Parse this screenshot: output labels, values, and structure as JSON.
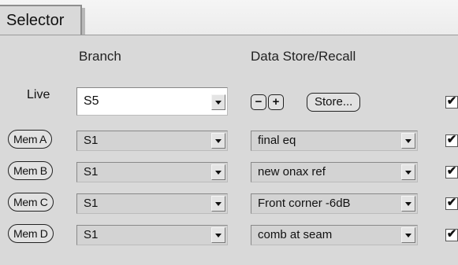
{
  "tab": {
    "label": "Selector"
  },
  "headers": {
    "branch": "Branch",
    "datastore": "Data Store/Recall"
  },
  "live": {
    "label": "Live",
    "branch": "S5",
    "minus_label": "−",
    "plus_label": "+",
    "store_label": "Store...",
    "checked_glyph": "✔"
  },
  "mem_rows": [
    {
      "button": "Mem A",
      "branch": "S1",
      "recall": "final eq",
      "checked_glyph": "✔"
    },
    {
      "button": "Mem B",
      "branch": "S1",
      "recall": "new onax ref",
      "checked_glyph": "✔"
    },
    {
      "button": "Mem C",
      "branch": "S1",
      "recall": "Front corner -6dB",
      "checked_glyph": "✔"
    },
    {
      "button": "Mem D",
      "branch": "S1",
      "recall": "comb at seam",
      "checked_glyph": "✔"
    }
  ],
  "colors": {
    "panel": "#d9d9d9",
    "tabstrip": "#f0f0f0",
    "live_field": "#ffffff",
    "disabled_field": "#d3d3d3"
  }
}
